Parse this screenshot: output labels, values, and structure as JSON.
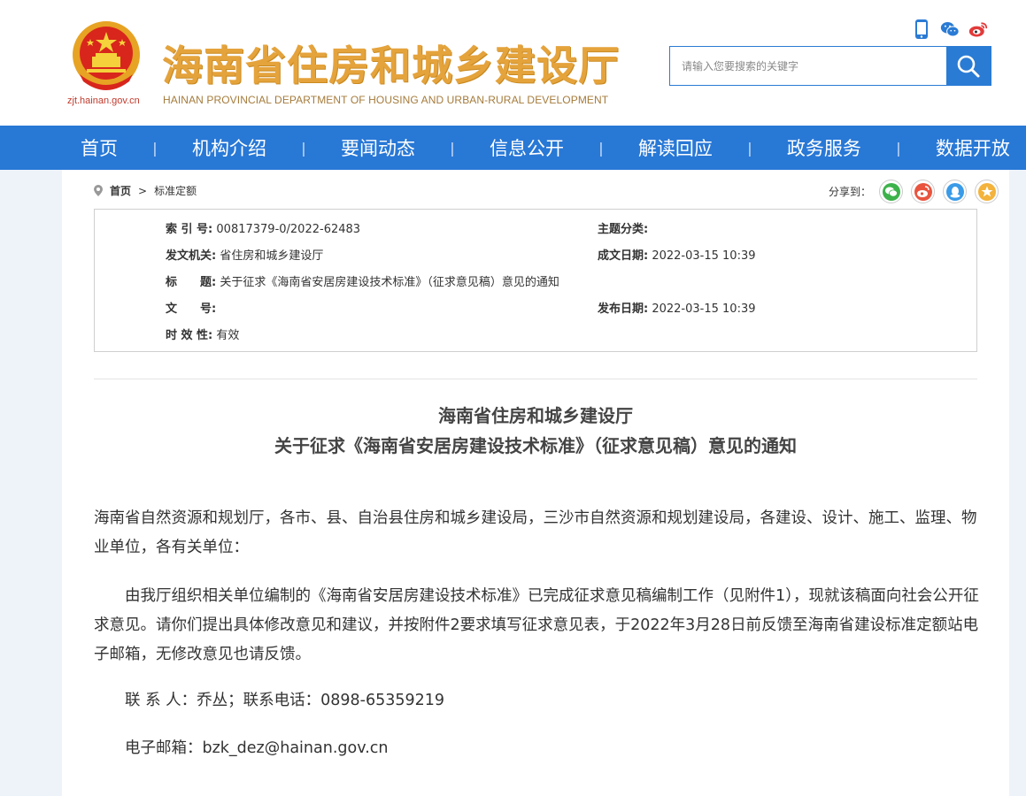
{
  "header": {
    "logo_cn": "海南省住房和城乡建设厅",
    "logo_en": "HAINAN PROVINCIAL DEPARTMENT OF HOUSING AND URBAN-RURAL DEVELOPMENT",
    "site_url": "zjt.hainan.gov.cn",
    "search_placeholder": "请输入您要搜索的关键字",
    "icons": [
      "mobile-icon",
      "wechat-icon",
      "weibo-icon"
    ]
  },
  "nav": {
    "items": [
      "首页",
      "机构介绍",
      "要闻动态",
      "信息公开",
      "解读回应",
      "政务服务",
      "数据开放"
    ],
    "separator": "|"
  },
  "breadcrumb": {
    "home": "首页",
    "separator": ">",
    "current": "标准定额"
  },
  "share": {
    "label": "分享到：",
    "buttons": [
      "wechat-icon",
      "weibo-icon",
      "qq-icon",
      "favorite-icon"
    ]
  },
  "meta": {
    "index_label": "索 引 号:",
    "index_value": "00817379-0/2022-62483",
    "category_label": "主题分类:",
    "category_value": "",
    "issuer_label": "发文机关:",
    "issuer_value": "省住房和城乡建设厅",
    "created_label": "成文日期:",
    "created_value": "2022-03-15 10:39",
    "title_label": "标　　题:",
    "title_value": "关于征求《海南省安居房建设技术标准》（征求意见稿）意见的通知",
    "docno_label": "文　　号:",
    "docno_value": "",
    "published_label": "发布日期:",
    "published_value": "2022-03-15 10:39",
    "validity_label": "时 效 性:",
    "validity_value": "有效"
  },
  "article": {
    "title_line1": "海南省住房和城乡建设厅",
    "title_line2": "关于征求《海南省安居房建设技术标准》（征求意见稿）意见的通知",
    "p1": "海南省自然资源和规划厅，各市、县、自治县住房和城乡建设局，三沙市自然资源和规划建设局，各建设、设计、施工、监理、物业单位，各有关单位：",
    "p2": "由我厅组织相关单位编制的《海南省安居房建设技术标准》已完成征求意见稿编制工作（见附件1），现就该稿面向社会公开征求意见。请你们提出具体修改意见和建议，并按附件2要求填写征求意见表，于2022年3月28日前反馈至海南省建设标准定额站电子邮箱，无修改意见也请反馈。",
    "p3": "联 系 人：乔丛；联系电话：0898-65359219",
    "p4": "电子邮箱：bzk_dez@hainan.gov.cn"
  },
  "colors": {
    "nav_bg": "#2878d6",
    "logo_gold": "#e5a33c",
    "emblem_red": "#d8261c"
  }
}
